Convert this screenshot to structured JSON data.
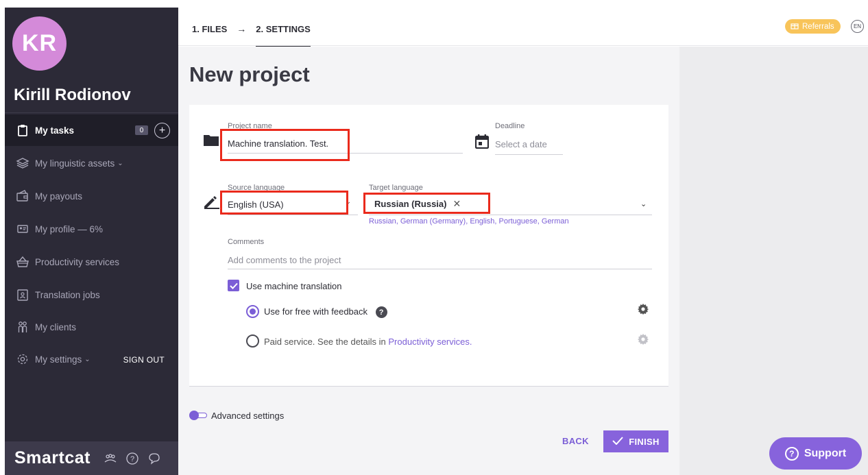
{
  "user": {
    "initials": "KR",
    "name": "Kirill Rodionov"
  },
  "sidebar": {
    "items": [
      {
        "label": "My tasks",
        "icon": "clipboard-icon",
        "badge": "0"
      },
      {
        "label": "My linguistic assets",
        "icon": "layers-icon"
      },
      {
        "label": "My payouts",
        "icon": "wallet-icon"
      },
      {
        "label": "My profile — 6%",
        "icon": "id-card-icon"
      },
      {
        "label": "Productivity services",
        "icon": "basket-icon"
      },
      {
        "label": "Translation jobs",
        "icon": "badge-icon"
      },
      {
        "label": "My clients",
        "icon": "people-icon"
      },
      {
        "label": "My settings",
        "icon": "gear-icon"
      }
    ],
    "sign_out": "SIGN OUT",
    "brand": "Smartcat"
  },
  "topbar": {
    "step1": "1. FILES",
    "step2": "2. SETTINGS",
    "referrals": "Referrals",
    "lang": "EN"
  },
  "page": {
    "title": "New project"
  },
  "form": {
    "project_name_label": "Project name",
    "project_name_value": "Machine translation. Test.",
    "deadline_label": "Deadline",
    "deadline_placeholder": "Select a date",
    "source_label": "Source language",
    "source_value": "English (USA)",
    "target_label": "Target language",
    "target_chip": "Russian (Russia)",
    "target_suggestions": "Russian, German (Germany), English, Portuguese, German",
    "comments_label": "Comments",
    "comments_placeholder": "Add comments to the project",
    "mt_label": "Use machine translation",
    "mt_option_free": "Use for free with feedback",
    "mt_option_paid_prefix": "Paid service. See the details in ",
    "mt_option_paid_link": "Productivity services",
    "mt_option_paid_suffix": "."
  },
  "advanced": {
    "label": "Advanced settings"
  },
  "actions": {
    "back": "BACK",
    "finish": "FINISH"
  },
  "support": {
    "label": "Support"
  },
  "colors": {
    "accent": "#8763dc",
    "highlight": "#ea2a1c",
    "sidebar": "#2c2a37",
    "referrals": "#f8c45a"
  }
}
